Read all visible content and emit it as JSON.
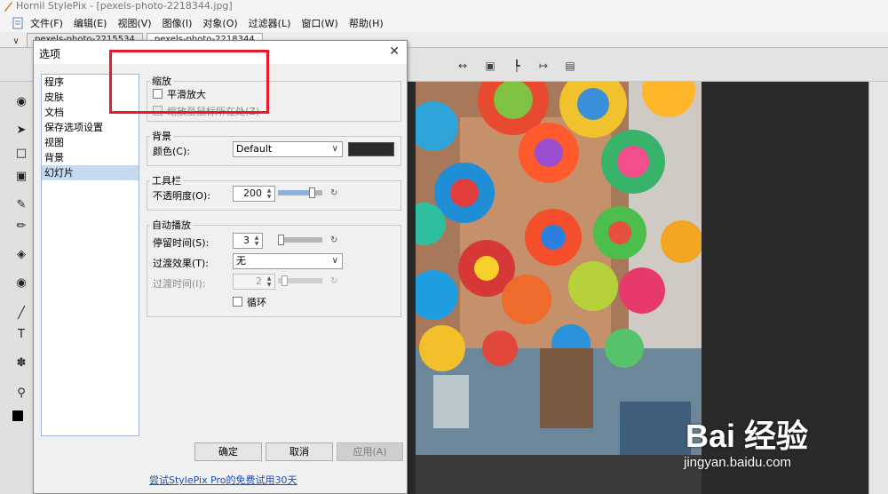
{
  "window": {
    "title": "Hornil StylePix - [pexels-photo-2218344.jpg]"
  },
  "menu": [
    "文件(F)",
    "编辑(E)",
    "视图(V)",
    "图像(I)",
    "对象(O)",
    "过滤器(L)",
    "窗口(W)",
    "帮助(H)"
  ],
  "doc_tabs": [
    "pexels-photo-2215534",
    "pexels-photo-2218344"
  ],
  "dialog": {
    "title": "选项",
    "nav": [
      "程序",
      "皮肤",
      "文档",
      "保存选项设置",
      "视图",
      "背景",
      "幻灯片"
    ],
    "selected_nav": "幻灯片",
    "zoom": {
      "label": "缩放",
      "smooth_zoom": "平滑放大",
      "zoom_to_cursor": "缩放至鼠标所在处(Z)"
    },
    "background": {
      "label": "背景",
      "color_label": "颜色(C):",
      "color_value": "Default",
      "swatch_color": "#2b2b2b"
    },
    "toolbar": {
      "label": "工具栏",
      "opacity_label": "不透明度(O):",
      "opacity_value": "200",
      "opacity_fraction": 0.78
    },
    "autoplay": {
      "label": "自动播放",
      "stay_label": "停留时间(S):",
      "stay_value": "3",
      "transition_label": "过渡效果(T):",
      "transition_value": "无",
      "transition_time_label": "过渡时间(I):",
      "transition_time_value": "2",
      "loop_label": "循环"
    },
    "buttons": {
      "ok": "确定",
      "cancel": "取消",
      "apply": "应用(A)"
    },
    "promo_link": "尝试StylePix Pro的免费试用30天"
  },
  "watermark": {
    "brand": "Bai 经验",
    "site": "jingyan.baidu.com"
  },
  "colors": {
    "annotation": "#e8192b",
    "selection": "#c5d9ef",
    "link": "#1a4fb8"
  }
}
